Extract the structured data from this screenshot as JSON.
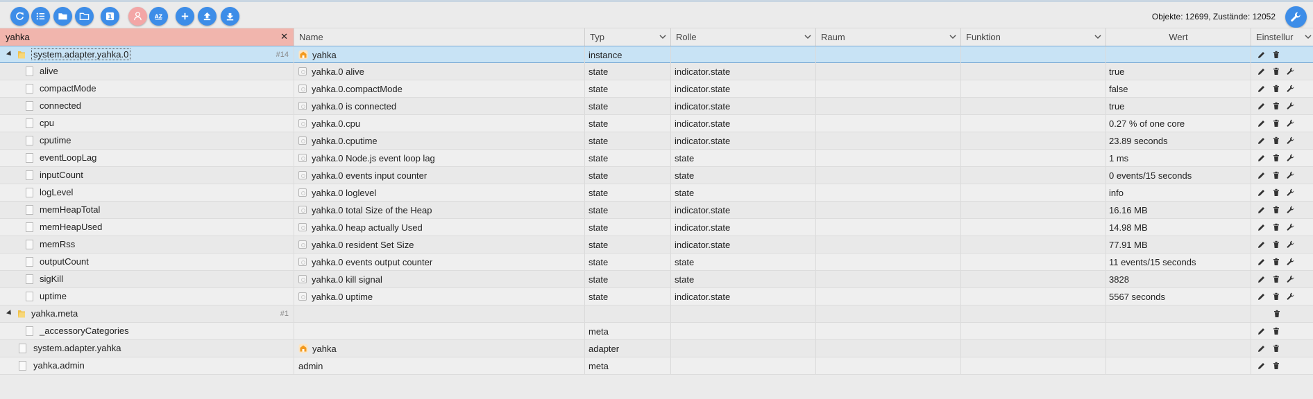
{
  "toolbar": {
    "buttons": [
      {
        "name": "refresh-button",
        "icon": "refresh-icon"
      },
      {
        "name": "list-view-button",
        "icon": "list-icon"
      },
      {
        "name": "folder-closed-button",
        "icon": "folder-icon"
      },
      {
        "name": "folder-open-button",
        "icon": "folder-open-icon"
      },
      {
        "name": "number-one-button",
        "icon": "numbered-icon"
      },
      {
        "name": "expert-mode-button",
        "icon": "expert-icon"
      },
      {
        "name": "sort-az-button",
        "icon": "sort-az-icon"
      },
      {
        "name": "add-button",
        "icon": "plus-icon"
      },
      {
        "name": "upload-button",
        "icon": "upload-icon"
      },
      {
        "name": "download-button",
        "icon": "download-icon"
      }
    ],
    "counts": "Objekte: 12699, Zustände: 12052"
  },
  "colors": {
    "accent": "#3d8de8",
    "filter_bg": "#f1b5ad",
    "selected_row": "#c8e3f5",
    "expert_button": "#f3a6a6"
  },
  "header": {
    "filter_value": "yahka",
    "columns": {
      "name": "Name",
      "typ": "Typ",
      "rolle": "Rolle",
      "raum": "Raum",
      "funktion": "Funktion",
      "wert": "Wert",
      "einstellungen": "Einstellur"
    }
  },
  "rows": [
    {
      "id": "system.adapter.yahka.0",
      "badge": "#14",
      "name": "yahka",
      "name_icon": "instance",
      "typ": "instance",
      "rolle": "",
      "wert": "",
      "level": 0,
      "folder": true,
      "selected": true,
      "actions": [
        "edit",
        "delete"
      ]
    },
    {
      "id": "alive",
      "name": "yahka.0 alive",
      "name_icon": "state",
      "typ": "state",
      "rolle": "indicator.state",
      "wert": "true",
      "level": 1,
      "actions": [
        "edit",
        "delete",
        "wrench"
      ]
    },
    {
      "id": "compactMode",
      "name": "yahka.0.compactMode",
      "name_icon": "state",
      "typ": "state",
      "rolle": "indicator.state",
      "wert": "false",
      "level": 1,
      "actions": [
        "edit",
        "delete",
        "wrench"
      ]
    },
    {
      "id": "connected",
      "name": "yahka.0 is connected",
      "name_icon": "state",
      "typ": "state",
      "rolle": "indicator.state",
      "wert": "true",
      "level": 1,
      "actions": [
        "edit",
        "delete",
        "wrench"
      ]
    },
    {
      "id": "cpu",
      "name": "yahka.0.cpu",
      "name_icon": "state",
      "typ": "state",
      "rolle": "indicator.state",
      "wert": "0.27 % of one core",
      "level": 1,
      "actions": [
        "edit",
        "delete",
        "wrench"
      ]
    },
    {
      "id": "cputime",
      "name": "yahka.0.cputime",
      "name_icon": "state",
      "typ": "state",
      "rolle": "indicator.state",
      "wert": "23.89 seconds",
      "level": 1,
      "actions": [
        "edit",
        "delete",
        "wrench"
      ]
    },
    {
      "id": "eventLoopLag",
      "name": "yahka.0 Node.js event loop lag",
      "name_icon": "state",
      "typ": "state",
      "rolle": "state",
      "wert": "1 ms",
      "level": 1,
      "actions": [
        "edit",
        "delete",
        "wrench"
      ]
    },
    {
      "id": "inputCount",
      "name": "yahka.0 events input counter",
      "name_icon": "state",
      "typ": "state",
      "rolle": "state",
      "wert": "0 events/15 seconds",
      "level": 1,
      "actions": [
        "edit",
        "delete",
        "wrench"
      ]
    },
    {
      "id": "logLevel",
      "name": "yahka.0 loglevel",
      "name_icon": "state",
      "typ": "state",
      "rolle": "state",
      "wert": "info",
      "level": 1,
      "actions": [
        "edit",
        "delete",
        "wrench"
      ]
    },
    {
      "id": "memHeapTotal",
      "name": "yahka.0 total Size of the Heap",
      "name_icon": "state",
      "typ": "state",
      "rolle": "indicator.state",
      "wert": "16.16 MB",
      "level": 1,
      "actions": [
        "edit",
        "delete",
        "wrench"
      ]
    },
    {
      "id": "memHeapUsed",
      "name": "yahka.0 heap actually Used",
      "name_icon": "state",
      "typ": "state",
      "rolle": "indicator.state",
      "wert": "14.98 MB",
      "level": 1,
      "actions": [
        "edit",
        "delete",
        "wrench"
      ]
    },
    {
      "id": "memRss",
      "name": "yahka.0 resident Set Size",
      "name_icon": "state",
      "typ": "state",
      "rolle": "indicator.state",
      "wert": "77.91 MB",
      "level": 1,
      "actions": [
        "edit",
        "delete",
        "wrench"
      ]
    },
    {
      "id": "outputCount",
      "name": "yahka.0 events output counter",
      "name_icon": "state",
      "typ": "state",
      "rolle": "state",
      "wert": "11 events/15 seconds",
      "level": 1,
      "actions": [
        "edit",
        "delete",
        "wrench"
      ]
    },
    {
      "id": "sigKill",
      "name": "yahka.0 kill signal",
      "name_icon": "state",
      "typ": "state",
      "rolle": "state",
      "wert": "3828",
      "level": 1,
      "actions": [
        "edit",
        "delete",
        "wrench"
      ]
    },
    {
      "id": "uptime",
      "name": "yahka.0 uptime",
      "name_icon": "state",
      "typ": "state",
      "rolle": "indicator.state",
      "wert": "5567 seconds",
      "level": 1,
      "actions": [
        "edit",
        "delete",
        "wrench"
      ]
    },
    {
      "id": "yahka.meta",
      "badge": "#1",
      "name": "",
      "name_icon": "",
      "typ": "",
      "rolle": "",
      "wert": "",
      "level": 0,
      "folder": true,
      "actions": [
        "delete"
      ]
    },
    {
      "id": "_accessoryCategories",
      "name": "",
      "name_icon": "",
      "typ": "meta",
      "rolle": "",
      "wert": "",
      "level": 1,
      "actions": [
        "edit",
        "delete"
      ]
    },
    {
      "id": "system.adapter.yahka",
      "name": "yahka",
      "name_icon": "instance",
      "typ": "adapter",
      "rolle": "",
      "wert": "",
      "level": 0,
      "file_top": true,
      "actions": [
        "edit",
        "delete"
      ]
    },
    {
      "id": "yahka.admin",
      "name": "admin",
      "name_icon": "",
      "typ": "meta",
      "rolle": "",
      "wert": "",
      "level": 0,
      "file_top": true,
      "actions": [
        "edit",
        "delete"
      ]
    }
  ]
}
